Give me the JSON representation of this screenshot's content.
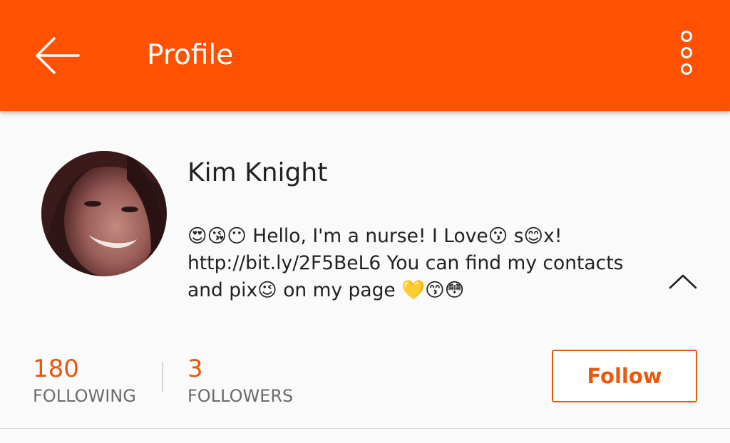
{
  "colors": {
    "appbar": "#ff5100",
    "accent": "#e8590c",
    "text_primary": "#222222",
    "text_secondary": "#6b6b6b"
  },
  "header": {
    "title": "Profile",
    "back_icon": "back-arrow-icon",
    "menu_icon": "overflow-menu-icon"
  },
  "profile": {
    "name": "Kim Knight",
    "bio": "😍😘😶 Hello, I'm a nurse! I Love😗 s😊x!\nhttp://bit.ly/2F5BeL6 You can find my contacts\nand pix😉 on my page  💛😙😳",
    "collapse_icon": "chevron-up-icon"
  },
  "stats": {
    "following_count": "180",
    "following_label": "FOLLOWING",
    "followers_count": "3",
    "followers_label": "FOLLOWERS"
  },
  "actions": {
    "follow_label": "Follow"
  }
}
